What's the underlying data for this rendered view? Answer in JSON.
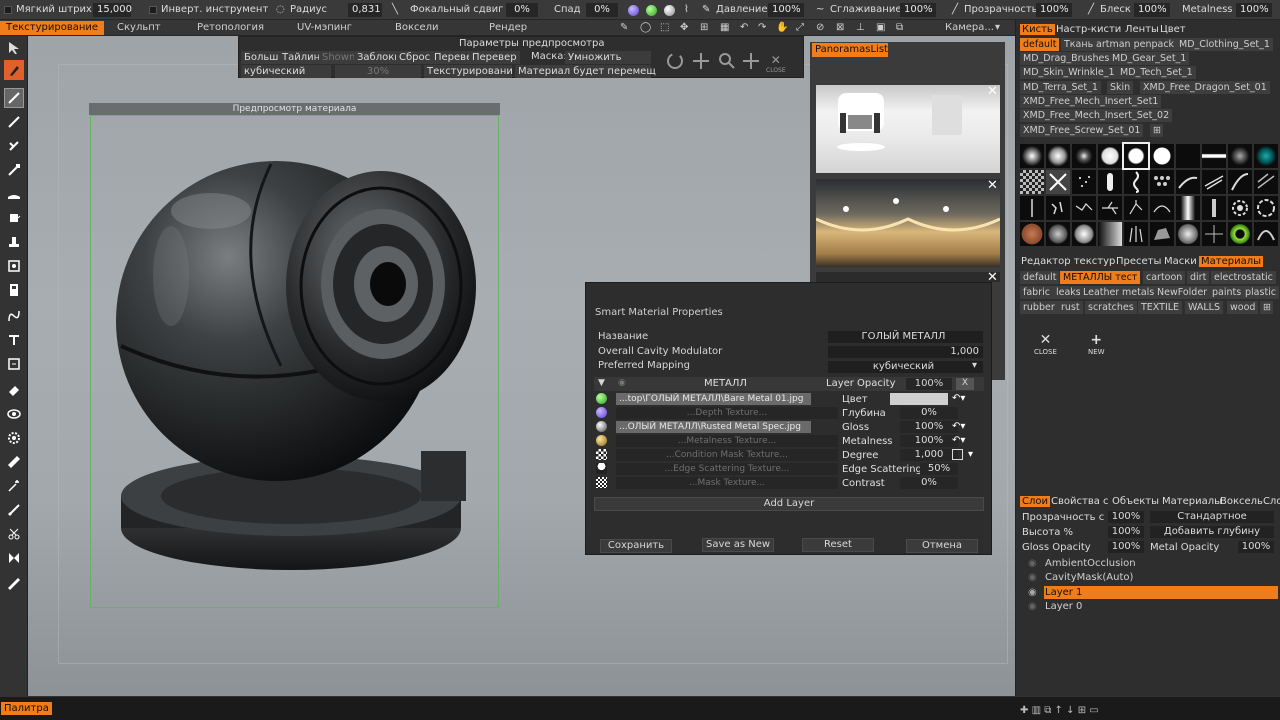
{
  "topbar": {
    "items": [
      {
        "label": "Мягкий штрих",
        "value": "15,000"
      },
      {
        "label": "Инверт. инструмент"
      },
      {
        "label": "Радиус",
        "value": "0,831"
      },
      {
        "label": "Фокальный сдвиг",
        "value": "0%"
      },
      {
        "label": "Спад",
        "value": "0%"
      },
      {
        "label": "Давление",
        "value": "100%"
      },
      {
        "label": "Сглаживание",
        "value": "100%"
      },
      {
        "label": "Прозрачность",
        "value": "100%"
      },
      {
        "label": "Блеск",
        "value": "100%"
      },
      {
        "label": "Metalness",
        "value": "100%"
      }
    ]
  },
  "rooms": {
    "items": [
      "Текстурирование",
      "Скульпт",
      "Ретопология",
      "UV-мэпинг",
      "Воксели",
      "Рендер"
    ],
    "camera": "Камера..."
  },
  "preview_params": {
    "title": "Параметры предпросмотра",
    "row1": [
      "Больше",
      "Тайлинг",
      "Shown",
      "Заблоки",
      "Сброс",
      "Перевер",
      "Перевер"
    ],
    "mask_label": "Маска:",
    "mask_value": "Умножить",
    "row2": [
      "кубический",
      "30%",
      "Текстурировани",
      "Материал будет перемещ"
    ],
    "close_label": "CLOSE"
  },
  "material_preview": {
    "title": "Предпросмотр материала"
  },
  "panoramas": {
    "tab": "PanoramasList"
  },
  "smart_material": {
    "title": "Smart Material Properties",
    "name_label": "Название",
    "name_value": "ГОЛЫЙ МЕТАЛЛ",
    "cavity_label": "Overall Cavity Modulator",
    "cavity_value": "1,000",
    "mapping_label": "Preferred Mapping",
    "mapping_value": "кубический",
    "layer_name": "МЕТАЛЛ",
    "layer_opacity_label": "Layer Opacity",
    "layer_opacity_value": "100%",
    "layer_close": "X",
    "textures": [
      {
        "text": "...top\\ГОЛЫЙ МЕТАЛЛ\\Bare Metal 01.jpg",
        "filled": true,
        "param": "Цвет",
        "value": ""
      },
      {
        "text": "...Depth Texture...",
        "filled": false,
        "param": "Глубина",
        "value": "0%"
      },
      {
        "text": "...ОЛЫЙ МЕТАЛЛ\\Rusted Metal Spec.jpg",
        "filled": true,
        "param": "Gloss",
        "value": "100%"
      },
      {
        "text": "...Metalness Texture...",
        "filled": false,
        "param": "Metalness",
        "value": "100%"
      },
      {
        "text": "...Condition Mask Texture...",
        "filled": false,
        "param": "Degree",
        "value": "1,000"
      },
      {
        "text": "...Edge Scattering Texture...",
        "filled": false,
        "param": "Edge Scattering",
        "value": "50%"
      },
      {
        "text": "...Mask Texture...",
        "filled": false,
        "param": "Contrast",
        "value": "0%"
      }
    ],
    "add_layer": "Add Layer",
    "buttons": [
      "Сохранить",
      "Save as New",
      "Reset",
      "Отмена"
    ],
    "color_swatch": "#d0d0d0"
  },
  "right_panel": {
    "tabs": [
      "Кисть",
      "Настр-кисти",
      "Ленты",
      "Цвет"
    ],
    "brush_packs": [
      "default",
      "Ткань",
      "artman penpack",
      "MD_Clothing_Set_1",
      "MD_Drag_Brushes",
      "MD_Gear_Set_1",
      "MD_Skin_Wrinkle_1",
      "MD_Tech_Set_1",
      "MD_Terra_Set_1",
      "Skin",
      "XMD_Free_Dragon_Set_01",
      "XMD_Free_Mech_Insert_Set1",
      "XMD_Free_Mech_Insert_Set_02",
      "XMD_Free_Screw_Set_01"
    ],
    "mat_tabs": [
      "Редактор текстур",
      "Пресеты",
      "Маски",
      "Материалы"
    ],
    "mat_sets": [
      "default",
      "МЕТАЛЛЫ тест",
      "cartoon",
      "dirt",
      "electrostatic",
      "fabric",
      "leaks",
      "Leather",
      "metals",
      "NewFolder",
      "paints",
      "plastic",
      "rubber",
      "rust",
      "scratches",
      "TEXTILE",
      "WALLS",
      "wood"
    ],
    "close_label": "CLOSE",
    "new_label": "NEW",
    "layer_tabs": [
      "Слои",
      "Свойства с",
      "Объекты",
      "Материалы",
      "ВоксельСлои"
    ],
    "props": {
      "opacity_label": "Прозрачность с",
      "opacity_value": "100%",
      "blend_value": "Стандартное",
      "height_label": "Высота %",
      "height_value": "100%",
      "depth_value": "Добавить глубину",
      "gloss_label": "Gloss Opacity",
      "gloss_value": "100%",
      "metal_label": "Metal Opacity",
      "metal_value": "100%"
    },
    "layers": [
      "AmbientOcclusion",
      "CavityMask(Auto)",
      "Layer 1",
      "Layer 0"
    ]
  },
  "bottom": {
    "palette": "Палитра"
  }
}
